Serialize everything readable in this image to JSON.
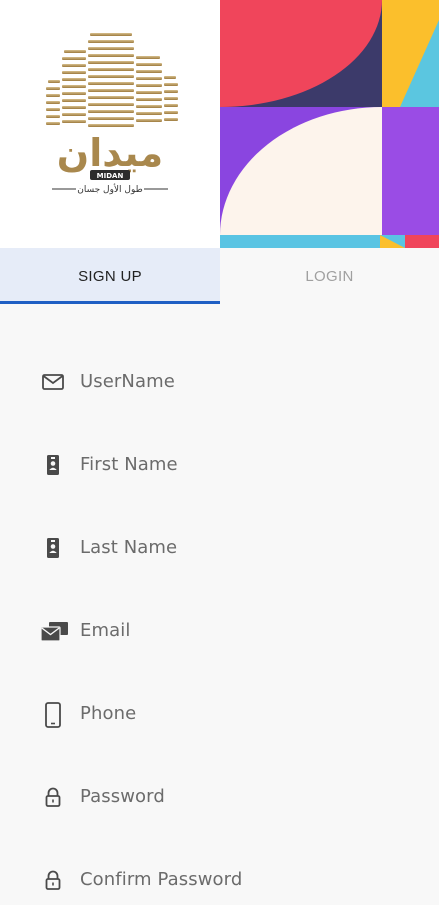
{
  "header": {
    "logo_text": "ميدان",
    "logo_badge": "MIDAN",
    "logo_tagline": "طول الأول جسان"
  },
  "tabs": {
    "signup_label": "SIGN UP",
    "login_label": "LOGIN"
  },
  "form": {
    "fields": [
      {
        "label": "UserName",
        "icon": "envelope-icon"
      },
      {
        "label": "First Name",
        "icon": "id-badge-icon"
      },
      {
        "label": "Last Name",
        "icon": "id-badge-icon"
      },
      {
        "label": "Email",
        "icon": "mail-stack-icon"
      },
      {
        "label": "Phone",
        "icon": "mobile-phone-icon"
      },
      {
        "label": "Password",
        "icon": "lock-icon"
      },
      {
        "label": "Confirm Password",
        "icon": "lock-icon"
      }
    ]
  },
  "colors": {
    "accent": "#1f5fc4",
    "active_tab_bg": "#e6ecf8",
    "logo_gold": "#b39257"
  }
}
